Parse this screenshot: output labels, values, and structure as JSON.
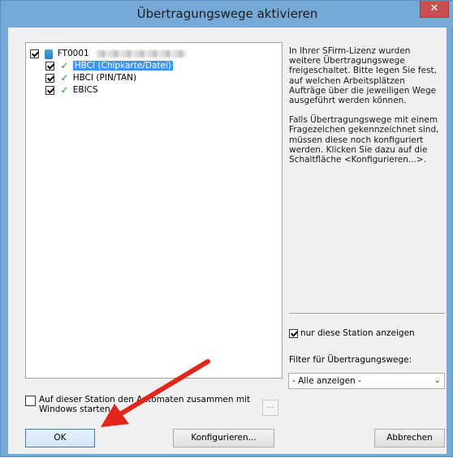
{
  "window": {
    "title": "Übertragungswege aktivieren",
    "close_label": "✕"
  },
  "tree": {
    "root": {
      "label": "FT0001",
      "checked": true
    },
    "items": [
      {
        "label": "HBCI (Chipkarte/Datei)",
        "checked": true,
        "selected": true
      },
      {
        "label": "HBCI (PIN/TAN)",
        "checked": true,
        "selected": false
      },
      {
        "label": "EBICS",
        "checked": true,
        "selected": false
      }
    ]
  },
  "info": {
    "paragraph1": "In Ihrer SFirm-Lizenz wurden weitere Übertragungswege freigeschaltet. Bitte legen Sie fest, auf welchen Arbeitsplätzen Aufträge über die jeweiligen Wege ausgeführt werden können.",
    "paragraph2": "Falls Übertragungswege mit einem Fragezeichen gekennzeichnet sind, müssen diese noch konfiguriert werden. Klicken Sie dazu auf die Schaltfläche <Konfigurieren...>."
  },
  "filters": {
    "station_only_label": "nur diese Station anzeigen",
    "station_only_checked": true,
    "filter_label": "Filter für Übertragungswege:",
    "filter_value": "- Alle anzeigen -"
  },
  "autostart": {
    "label": "Auf dieser Station den Automaten zusammen mit Windows starten",
    "checked": false,
    "dots_label": "..."
  },
  "buttons": {
    "ok": "OK",
    "configure": "Konfigurieren...",
    "cancel": "Abbrechen"
  },
  "colors": {
    "titlebar": "#76a9d6",
    "close": "#c75050",
    "selection": "#3399ff",
    "check_green": "#1aa01a",
    "arrow": "#e3261c"
  }
}
